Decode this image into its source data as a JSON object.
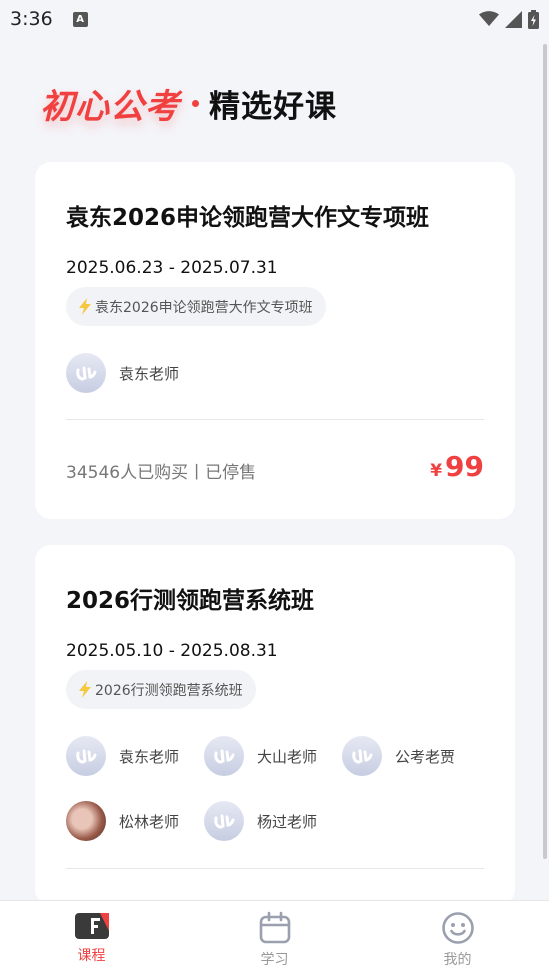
{
  "status_bar": {
    "time": "3:36",
    "notification_badge": "A",
    "icons": [
      "wifi-icon",
      "signal-icon",
      "battery-icon"
    ]
  },
  "header": {
    "brand": "初心公考",
    "subtitle": "精选好课"
  },
  "courses": [
    {
      "title": "袁东2026申论领跑营大作文专项班",
      "dates": "2025.06.23 - 2025.07.31",
      "tag": "袁东2026申论领跑营大作文专项班",
      "teachers": [
        {
          "name": "袁东老师",
          "avatar": "logo"
        }
      ],
      "sales": "34546人已购买丨已停售",
      "price_symbol": "¥",
      "price": "99"
    },
    {
      "title": "2026行测领跑营系统班",
      "dates": "2025.05.10 - 2025.08.31",
      "tag": "2026行测领跑营系统班",
      "teachers": [
        {
          "name": "袁东老师",
          "avatar": "logo"
        },
        {
          "name": "大山老师",
          "avatar": "logo"
        },
        {
          "name": "公考老贾",
          "avatar": "logo"
        },
        {
          "name": "松林老师",
          "avatar": "photo"
        },
        {
          "name": "杨过老师",
          "avatar": "logo"
        }
      ]
    }
  ],
  "tabbar": {
    "tabs": [
      {
        "label": "课程",
        "icon": "course-book-icon",
        "active": true
      },
      {
        "label": "学习",
        "icon": "calendar-icon",
        "active": false
      },
      {
        "label": "我的",
        "icon": "smiley-face-icon",
        "active": false
      }
    ]
  },
  "colors": {
    "accent": "#ef4141",
    "background": "#f4f5f9",
    "card": "#ffffff",
    "tag_icon": "#f5c842"
  }
}
